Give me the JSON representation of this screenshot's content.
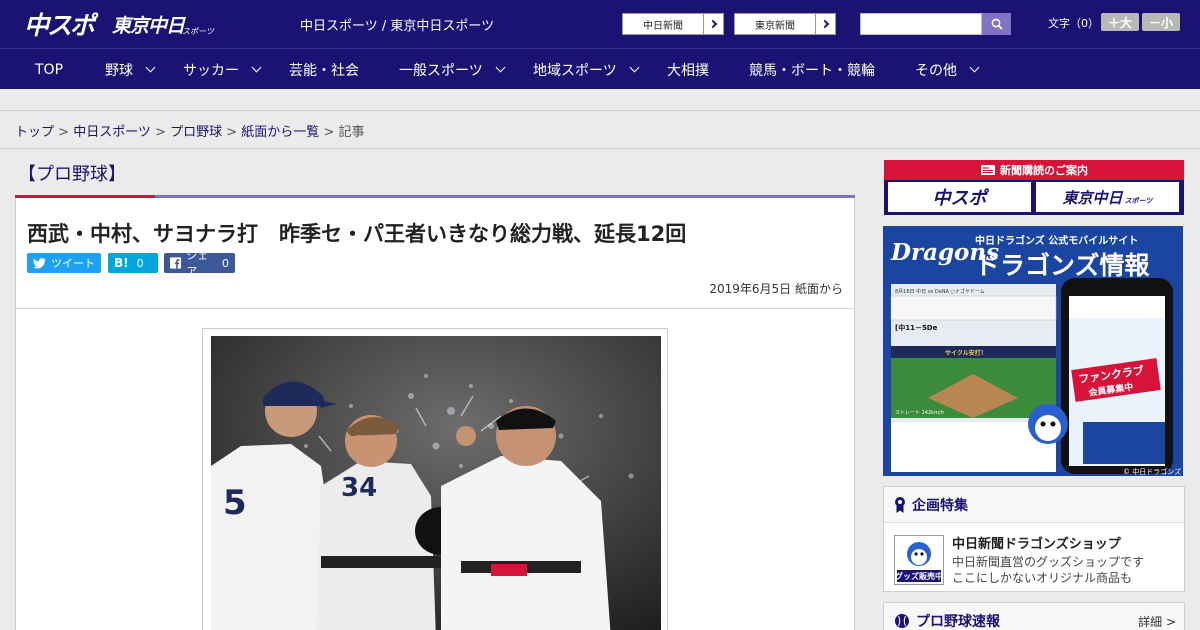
{
  "header": {
    "logo_main": "中スポ",
    "logo_tokyo": "東京中日",
    "logo_sports": "スポーツ",
    "site_name": "中日スポーツ / 東京中日スポーツ",
    "paper_links": [
      "中日新聞",
      "東京新聞"
    ],
    "search_placeholder": "",
    "font_size_label": "文字（0）",
    "font_larger": "＋大",
    "font_smaller": "－小"
  },
  "nav": {
    "items": [
      {
        "label": "TOP",
        "dropdown": false
      },
      {
        "label": "野球",
        "dropdown": true
      },
      {
        "label": "サッカー",
        "dropdown": true
      },
      {
        "label": "芸能・社会",
        "dropdown": false
      },
      {
        "label": "一般スポーツ",
        "dropdown": true
      },
      {
        "label": "地域スポーツ",
        "dropdown": true
      },
      {
        "label": "大相撲",
        "dropdown": false
      },
      {
        "label": "競馬・ボート・競輪",
        "dropdown": false
      },
      {
        "label": "その他",
        "dropdown": true
      }
    ]
  },
  "breadcrumb": {
    "links": [
      "トップ",
      "中日スポーツ",
      "プロ野球",
      "紙面から一覧"
    ],
    "separator": " > ",
    "current": "記事"
  },
  "article": {
    "category": "【プロ野球】",
    "headline": "西武・中村、サヨナラ打　昨季セ・パ王者いきなり総力戦、延長12回",
    "share": {
      "twitter": "ツイート",
      "hatena_icon": "B!",
      "hatena_count": "0",
      "facebook": "シェア",
      "facebook_count": "0"
    },
    "date": "2019年6月5日 紙面から"
  },
  "sidebar": {
    "promo_title": "新聞購読のご案内",
    "promo_logos": [
      "中スポ",
      "東京中日"
    ],
    "promo_logo_sub": "スポーツ",
    "ad": {
      "team_brand": "Dragons",
      "subtitle": "中日ドラゴンズ 公式モバイルサイト",
      "title": "ドラゴンズ情報",
      "phone_badge_line1": "ファンクラブ",
      "phone_badge_line2": "会員募集中",
      "score_caption": "8月16日 中日 vs DeNA ○ナゴヤドーム",
      "score_display": "[中11－5De",
      "cycle_hit": "サイクル安打！",
      "pitch_info": "ストレート 142km/h",
      "tab_labels": [
        "速報",
        "ニュース",
        "ムービー",
        "チケット",
        "イベント",
        "写真"
      ],
      "copyright": "© 中日ドラゴンズ"
    },
    "feature": {
      "title": "企画特集",
      "shop_thumb_label": "グッズ販売中",
      "shop_title": "中日新聞ドラゴンズショップ",
      "shop_desc_1": "中日新聞直営のグッズショップです",
      "shop_desc_2": "ここにしかないオリジナル商品も"
    },
    "baseball": {
      "title": "プロ野球速報",
      "more": "詳細 >"
    }
  },
  "colors": {
    "brand_navy": "#1b1373",
    "accent_red": "#d8133a",
    "search_button": "#8073c6",
    "twitter": "#1da1f2",
    "hatena": "#00a4de",
    "facebook": "#3b5998"
  }
}
